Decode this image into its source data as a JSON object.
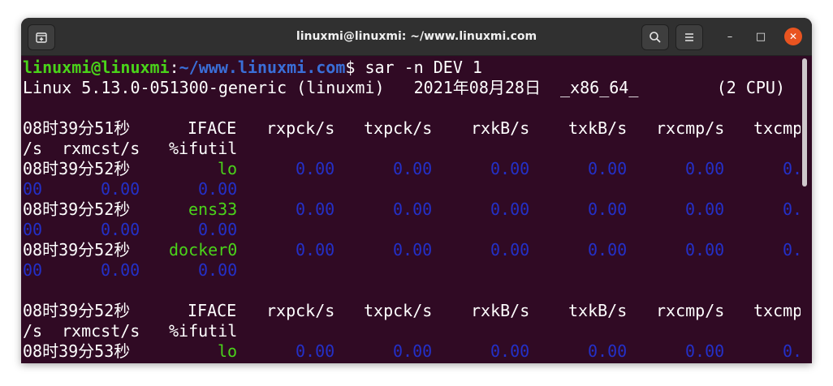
{
  "window": {
    "title": "linuxmi@linuxmi: ~/www.linuxmi.com",
    "icons": {
      "new_tab": "new-tab-icon",
      "search": "search-icon",
      "menu": "hamburger-menu-icon",
      "minimize": "minimize-icon",
      "maximize": "maximize-icon",
      "close": "close-icon"
    },
    "minimize_glyph": "–",
    "maximize_glyph": "□",
    "close_glyph": "✕"
  },
  "terminal": {
    "prompt_user": "linuxmi@linuxmi",
    "prompt_sep": ":",
    "prompt_path": "~/www.linuxmi.com",
    "prompt_symbol": "$ ",
    "command": "sar -n DEV 1",
    "sysinfo": "Linux 5.13.0-051300-generic (linuxmi)   2021年08月28日  _x86_64_        (2 CPU)",
    "header1": {
      "time": "08时39分51秒",
      "iface": "IFACE",
      "rxpck": "rxpck/s",
      "txpck": "txpck/s",
      "rxkb": "rxkB/s",
      "txkb": "txkB/s",
      "rxcmp": "rxcmp/s",
      "txcmp_head": "txcmp",
      "txcmp_tail": "/s",
      "rxmcst": "rxmcst/s",
      "ifutil": "%ifutil"
    },
    "rows1": [
      {
        "time": "08时39分52秒",
        "iface": "lo",
        "rxpck": "0.00",
        "txpck": "0.00",
        "rxkb": "0.00",
        "txkb": "0.00",
        "rxcmp": "0.00",
        "txcmp_head": "0.",
        "txcmp_tail": "00",
        "rxmcst": "0.00",
        "ifutil": "0.00"
      },
      {
        "time": "08时39分52秒",
        "iface": "ens33",
        "rxpck": "0.00",
        "txpck": "0.00",
        "rxkb": "0.00",
        "txkb": "0.00",
        "rxcmp": "0.00",
        "txcmp_head": "0.",
        "txcmp_tail": "00",
        "rxmcst": "0.00",
        "ifutil": "0.00"
      },
      {
        "time": "08时39分52秒",
        "iface": "docker0",
        "rxpck": "0.00",
        "txpck": "0.00",
        "rxkb": "0.00",
        "txkb": "0.00",
        "rxcmp": "0.00",
        "txcmp_head": "0.",
        "txcmp_tail": "00",
        "rxmcst": "0.00",
        "ifutil": "0.00"
      }
    ],
    "header2": {
      "time": "08时39分52秒",
      "iface": "IFACE",
      "rxpck": "rxpck/s",
      "txpck": "txpck/s",
      "rxkb": "rxkB/s",
      "txkb": "txkB/s",
      "rxcmp": "rxcmp/s",
      "txcmp_head": "txcmp",
      "txcmp_tail": "/s",
      "rxmcst": "rxmcst/s",
      "ifutil": "%ifutil"
    },
    "rows2": [
      {
        "time": "08时39分53秒",
        "iface": "lo",
        "rxpck": "0.00",
        "txpck": "0.00",
        "rxkb": "0.00",
        "txkb": "0.00",
        "rxcmp": "0.00",
        "txcmp_head": "0."
      }
    ]
  },
  "colors": {
    "terminal_bg": "#300a24",
    "titlebar_bg": "#303030",
    "prompt_green": "#4ad31a",
    "path_blue": "#3a6fd8",
    "value_blue": "#2430c8",
    "close_orange": "#e95420"
  }
}
